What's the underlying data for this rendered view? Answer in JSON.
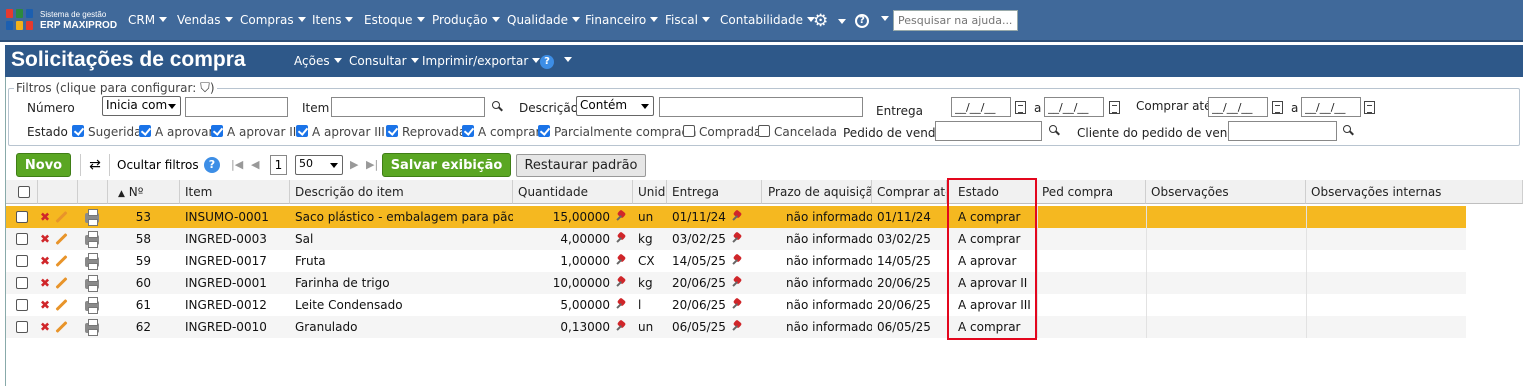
{
  "brand": {
    "line1": "Sistema de gestão",
    "line2": "ERP MAXIPROD"
  },
  "top_menu": [
    "CRM",
    "Vendas",
    "Compras",
    "Itens",
    "Estoque",
    "Produção",
    "Qualidade",
    "Financeiro",
    "Fiscal",
    "Contabilidade"
  ],
  "help_search": {
    "placeholder": "Pesquisar na ajuda..."
  },
  "page": {
    "title": "Solicitações de compra",
    "menus": [
      "Ações",
      "Consultar",
      "Imprimir/exportar"
    ]
  },
  "filters": {
    "legend": "Filtros (clique para configurar:",
    "numero_label": "Número",
    "numero_mode": "Inicia com",
    "item_label": "Item",
    "descricao_label": "Descrição",
    "descricao_mode": "Contém",
    "entrega_label": "Entrega",
    "entrega_from": "__/__/__",
    "a1": "a",
    "entrega_to": "__/__/__",
    "comprar_ate_label": "Comprar até",
    "comprar_from": "__/__/__",
    "a2": "a",
    "comprar_to": "__/__/__",
    "estado_label": "Estado",
    "estados": [
      {
        "label": "Sugerida",
        "checked": true
      },
      {
        "label": "A aprovar",
        "checked": true
      },
      {
        "label": "A aprovar II",
        "checked": true
      },
      {
        "label": "A aprovar III",
        "checked": true
      },
      {
        "label": "Reprovada",
        "checked": true
      },
      {
        "label": "A comprar",
        "checked": true
      },
      {
        "label": "Parcialmente comprada",
        "checked": true
      },
      {
        "label": "Comprada",
        "checked": false
      },
      {
        "label": "Cancelada",
        "checked": false
      }
    ],
    "pedido_venda_label": "Pedido de venda",
    "cliente_pedido_label": "Cliente do pedido de venda"
  },
  "toolbar": {
    "novo": "Novo",
    "ocultar": "Ocultar filtros",
    "page": "1",
    "per_page": "50",
    "salvar": "Salvar exibição",
    "restaurar": "Restaurar padrão"
  },
  "columns": [
    "Nº",
    "Item",
    "Descrição do item",
    "Quantidade",
    "Unid",
    "Entrega",
    "Prazo de aquisição",
    "Comprar até",
    "Estado",
    "Ped compra",
    "Observações",
    "Observações internas"
  ],
  "rows": [
    {
      "n": "53",
      "item": "INSUMO-0001",
      "desc": "Saco plástico - embalagem para pão",
      "qtd": "15,00000",
      "unid": "un",
      "entrega": "01/11/24",
      "prazo": "não informado",
      "comprar": "01/11/24",
      "estado": "A comprar",
      "highlight": true
    },
    {
      "n": "58",
      "item": "INGRED-0003",
      "desc": "Sal",
      "qtd": "4,00000",
      "unid": "kg",
      "entrega": "03/02/25",
      "prazo": "não informado",
      "comprar": "03/02/25",
      "estado": "A comprar",
      "highlight": false
    },
    {
      "n": "59",
      "item": "INGRED-0017",
      "desc": "Fruta",
      "qtd": "1,00000",
      "unid": "CX",
      "entrega": "14/05/25",
      "prazo": "não informado",
      "comprar": "14/05/25",
      "estado": "A aprovar",
      "highlight": false
    },
    {
      "n": "60",
      "item": "INGRED-0001",
      "desc": "Farinha de trigo",
      "qtd": "10,00000",
      "unid": "kg",
      "entrega": "20/06/25",
      "prazo": "não informado",
      "comprar": "20/06/25",
      "estado": "A aprovar II",
      "highlight": false
    },
    {
      "n": "61",
      "item": "INGRED-0012",
      "desc": "Leite Condensado",
      "qtd": "5,00000",
      "unid": "l",
      "entrega": "20/06/25",
      "prazo": "não informado",
      "comprar": "20/06/25",
      "estado": "A aprovar III",
      "highlight": false
    },
    {
      "n": "62",
      "item": "INGRED-0010",
      "desc": "Granulado",
      "qtd": "0,13000",
      "unid": "un",
      "entrega": "06/05/25",
      "prazo": "não informado",
      "comprar": "06/05/25",
      "estado": "A comprar",
      "highlight": false
    }
  ],
  "colors": {
    "topbar": "#40699a",
    "titlebar": "#2e5889",
    "highlight_row": "#f5b820",
    "green": "#5aa623",
    "annotation": "#e3061d"
  }
}
